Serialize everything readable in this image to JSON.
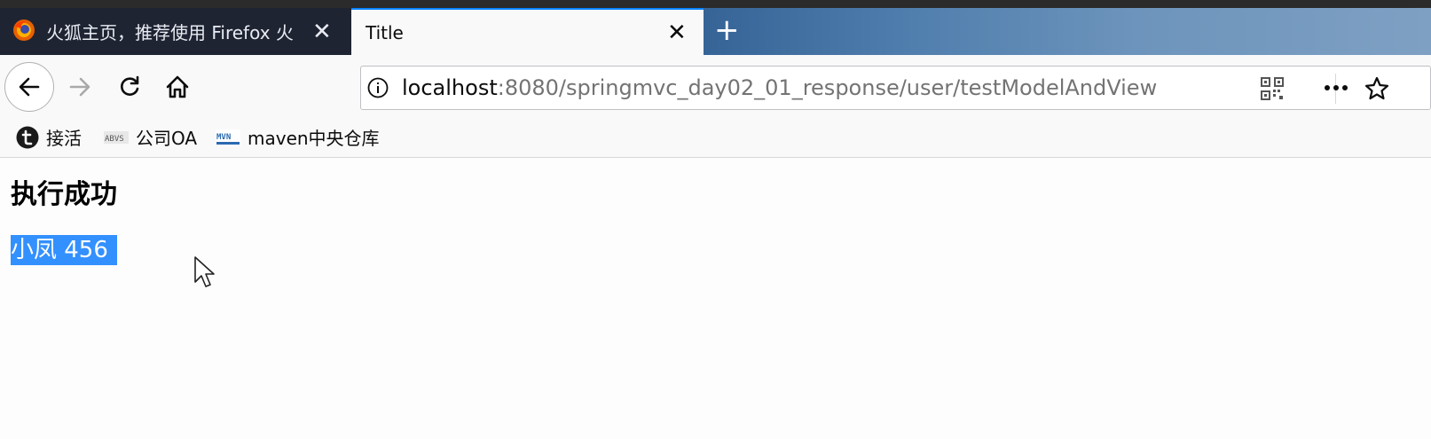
{
  "tabs": [
    {
      "title": "火狐主页，推荐使用 Firefox 火",
      "icon": "firefox-icon",
      "active": false
    },
    {
      "title": "Title",
      "active": true
    }
  ],
  "toolbar": {
    "url_host": "localhost",
    "url_rest": ":8080/springmvc_day02_01_response/user/testModelAndView"
  },
  "bookmarks": [
    {
      "label": "接活",
      "icon": "t-logo-icon"
    },
    {
      "label": "公司OA",
      "icon": "abvs-icon"
    },
    {
      "label": "maven中央仓库",
      "icon": "mvn-icon"
    }
  ],
  "page": {
    "heading": "执行成功",
    "selected_text": "小凤 456"
  },
  "colors": {
    "selection": "#3390ff",
    "tab_accent": "#0a84ff",
    "tabbar": "#1f2433"
  }
}
